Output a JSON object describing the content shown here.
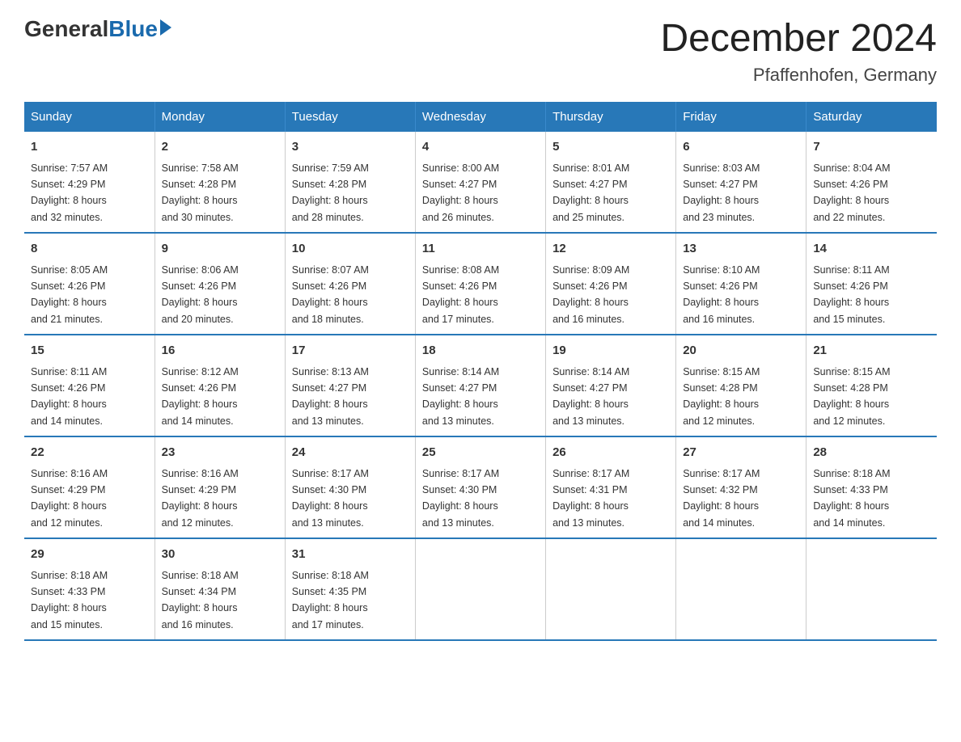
{
  "header": {
    "logo_general": "General",
    "logo_blue": "Blue",
    "month_title": "December 2024",
    "location": "Pfaffenhofen, Germany"
  },
  "weekdays": [
    "Sunday",
    "Monday",
    "Tuesday",
    "Wednesday",
    "Thursday",
    "Friday",
    "Saturday"
  ],
  "weeks": [
    [
      {
        "day": "1",
        "sunrise": "7:57 AM",
        "sunset": "4:29 PM",
        "daylight": "8 hours and 32 minutes."
      },
      {
        "day": "2",
        "sunrise": "7:58 AM",
        "sunset": "4:28 PM",
        "daylight": "8 hours and 30 minutes."
      },
      {
        "day": "3",
        "sunrise": "7:59 AM",
        "sunset": "4:28 PM",
        "daylight": "8 hours and 28 minutes."
      },
      {
        "day": "4",
        "sunrise": "8:00 AM",
        "sunset": "4:27 PM",
        "daylight": "8 hours and 26 minutes."
      },
      {
        "day": "5",
        "sunrise": "8:01 AM",
        "sunset": "4:27 PM",
        "daylight": "8 hours and 25 minutes."
      },
      {
        "day": "6",
        "sunrise": "8:03 AM",
        "sunset": "4:27 PM",
        "daylight": "8 hours and 23 minutes."
      },
      {
        "day": "7",
        "sunrise": "8:04 AM",
        "sunset": "4:26 PM",
        "daylight": "8 hours and 22 minutes."
      }
    ],
    [
      {
        "day": "8",
        "sunrise": "8:05 AM",
        "sunset": "4:26 PM",
        "daylight": "8 hours and 21 minutes."
      },
      {
        "day": "9",
        "sunrise": "8:06 AM",
        "sunset": "4:26 PM",
        "daylight": "8 hours and 20 minutes."
      },
      {
        "day": "10",
        "sunrise": "8:07 AM",
        "sunset": "4:26 PM",
        "daylight": "8 hours and 18 minutes."
      },
      {
        "day": "11",
        "sunrise": "8:08 AM",
        "sunset": "4:26 PM",
        "daylight": "8 hours and 17 minutes."
      },
      {
        "day": "12",
        "sunrise": "8:09 AM",
        "sunset": "4:26 PM",
        "daylight": "8 hours and 16 minutes."
      },
      {
        "day": "13",
        "sunrise": "8:10 AM",
        "sunset": "4:26 PM",
        "daylight": "8 hours and 16 minutes."
      },
      {
        "day": "14",
        "sunrise": "8:11 AM",
        "sunset": "4:26 PM",
        "daylight": "8 hours and 15 minutes."
      }
    ],
    [
      {
        "day": "15",
        "sunrise": "8:11 AM",
        "sunset": "4:26 PM",
        "daylight": "8 hours and 14 minutes."
      },
      {
        "day": "16",
        "sunrise": "8:12 AM",
        "sunset": "4:26 PM",
        "daylight": "8 hours and 14 minutes."
      },
      {
        "day": "17",
        "sunrise": "8:13 AM",
        "sunset": "4:27 PM",
        "daylight": "8 hours and 13 minutes."
      },
      {
        "day": "18",
        "sunrise": "8:14 AM",
        "sunset": "4:27 PM",
        "daylight": "8 hours and 13 minutes."
      },
      {
        "day": "19",
        "sunrise": "8:14 AM",
        "sunset": "4:27 PM",
        "daylight": "8 hours and 13 minutes."
      },
      {
        "day": "20",
        "sunrise": "8:15 AM",
        "sunset": "4:28 PM",
        "daylight": "8 hours and 12 minutes."
      },
      {
        "day": "21",
        "sunrise": "8:15 AM",
        "sunset": "4:28 PM",
        "daylight": "8 hours and 12 minutes."
      }
    ],
    [
      {
        "day": "22",
        "sunrise": "8:16 AM",
        "sunset": "4:29 PM",
        "daylight": "8 hours and 12 minutes."
      },
      {
        "day": "23",
        "sunrise": "8:16 AM",
        "sunset": "4:29 PM",
        "daylight": "8 hours and 12 minutes."
      },
      {
        "day": "24",
        "sunrise": "8:17 AM",
        "sunset": "4:30 PM",
        "daylight": "8 hours and 13 minutes."
      },
      {
        "day": "25",
        "sunrise": "8:17 AM",
        "sunset": "4:30 PM",
        "daylight": "8 hours and 13 minutes."
      },
      {
        "day": "26",
        "sunrise": "8:17 AM",
        "sunset": "4:31 PM",
        "daylight": "8 hours and 13 minutes."
      },
      {
        "day": "27",
        "sunrise": "8:17 AM",
        "sunset": "4:32 PM",
        "daylight": "8 hours and 14 minutes."
      },
      {
        "day": "28",
        "sunrise": "8:18 AM",
        "sunset": "4:33 PM",
        "daylight": "8 hours and 14 minutes."
      }
    ],
    [
      {
        "day": "29",
        "sunrise": "8:18 AM",
        "sunset": "4:33 PM",
        "daylight": "8 hours and 15 minutes."
      },
      {
        "day": "30",
        "sunrise": "8:18 AM",
        "sunset": "4:34 PM",
        "daylight": "8 hours and 16 minutes."
      },
      {
        "day": "31",
        "sunrise": "8:18 AM",
        "sunset": "4:35 PM",
        "daylight": "8 hours and 17 minutes."
      },
      null,
      null,
      null,
      null
    ]
  ],
  "labels": {
    "sunrise": "Sunrise:",
    "sunset": "Sunset:",
    "daylight": "Daylight:"
  }
}
